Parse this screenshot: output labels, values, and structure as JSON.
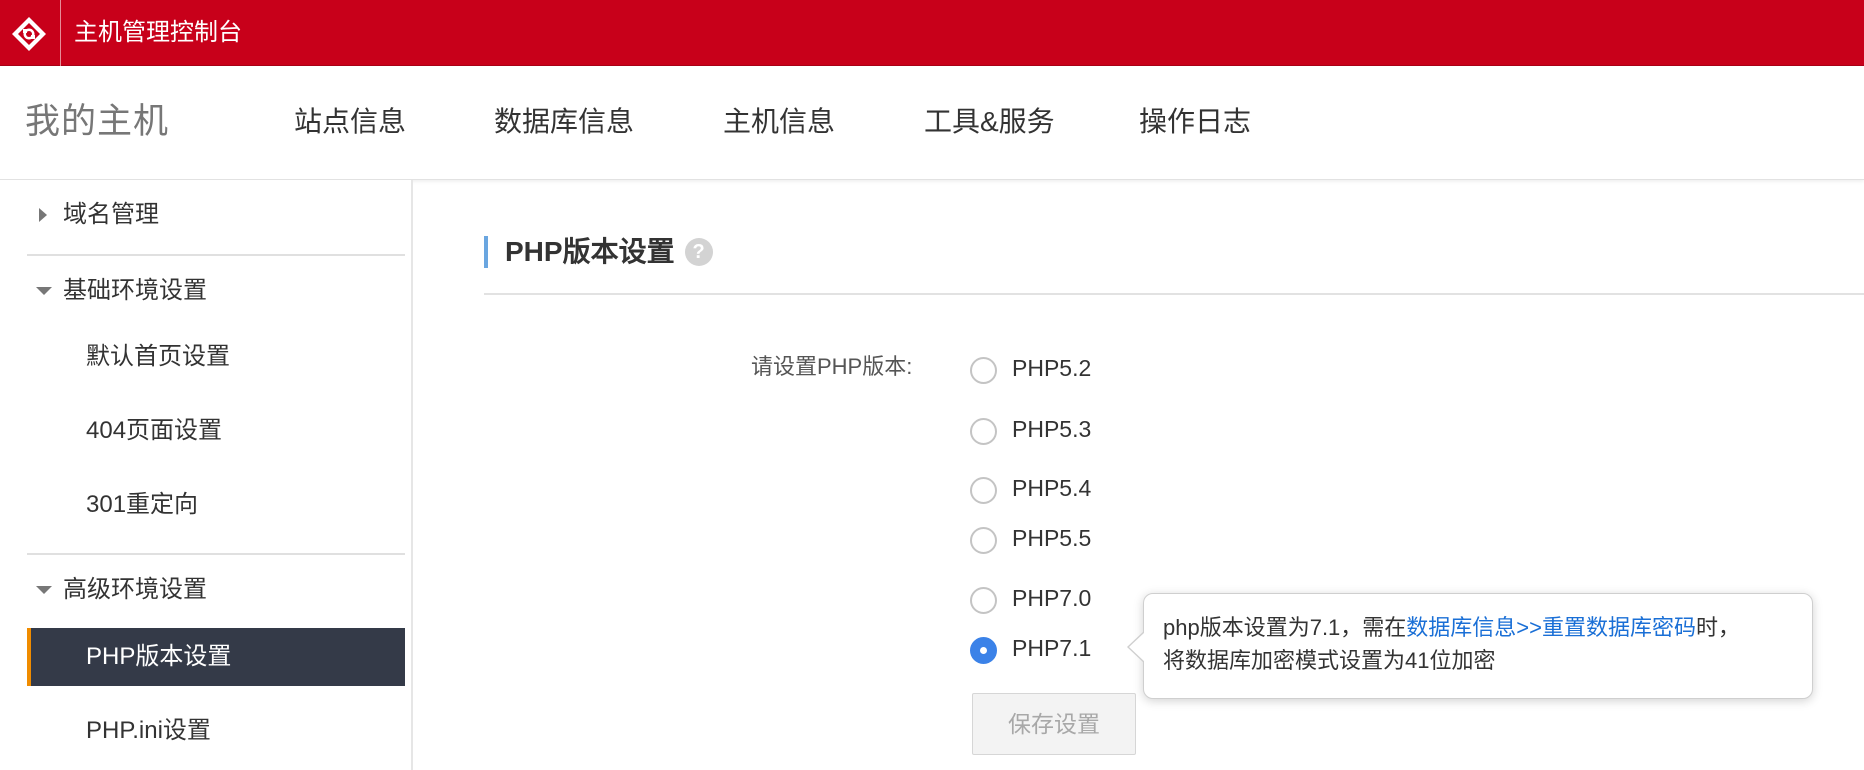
{
  "header": {
    "title": "主机管理控制台",
    "logo_icon": "brand-logo-icon",
    "bg_color": "#c8001a"
  },
  "nav": {
    "brand": "我的主机",
    "items": [
      {
        "label": "站点信息"
      },
      {
        "label": "数据库信息"
      },
      {
        "label": "主机信息"
      },
      {
        "label": "工具&服务"
      },
      {
        "label": "操作日志"
      }
    ]
  },
  "sidebar": {
    "groups": [
      {
        "label": "域名管理",
        "expanded": false,
        "items": []
      },
      {
        "label": "基础环境设置",
        "expanded": true,
        "items": [
          {
            "label": "默认首页设置"
          },
          {
            "label": "404页面设置"
          },
          {
            "label": "301重定向"
          }
        ]
      },
      {
        "label": "高级环境设置",
        "expanded": true,
        "items": [
          {
            "label": "PHP版本设置",
            "active": true
          },
          {
            "label": "PHP.ini设置"
          }
        ]
      }
    ],
    "active_color": "#343a48",
    "active_accent": "#f08c00"
  },
  "main": {
    "section_title": "PHP版本设置",
    "help_icon": "question-icon",
    "help_glyph": "?",
    "form_label": "请设置PHP版本:",
    "options": [
      {
        "label": "PHP5.2",
        "checked": false
      },
      {
        "label": "PHP5.3",
        "checked": false
      },
      {
        "label": "PHP5.4",
        "checked": false
      },
      {
        "label": "PHP5.5",
        "checked": false
      },
      {
        "label": "PHP7.0",
        "checked": false
      },
      {
        "label": "PHP7.1",
        "checked": true
      }
    ],
    "save_label": "保存设置",
    "tooltip": {
      "line1_prefix": "php版本设置为7.1，需在",
      "link": "数据库信息>>重置数据库密码",
      "line1_suffix": "时，",
      "line2": "将数据库加密模式设置为41位加密"
    },
    "link_color": "#1a6fd6",
    "radio_checked_color": "#3b82e8"
  }
}
